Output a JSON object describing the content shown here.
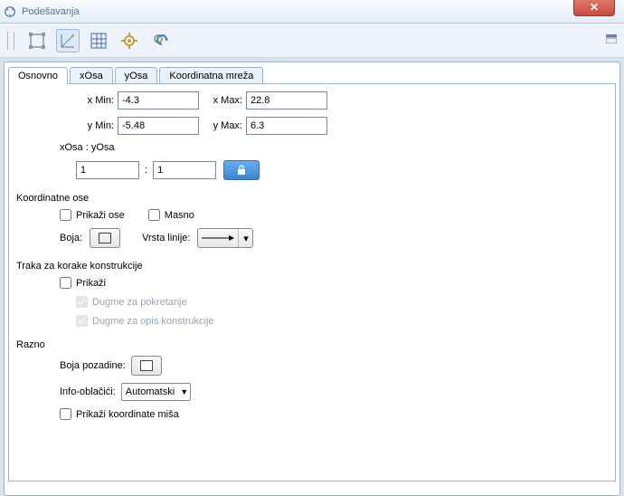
{
  "title": "Podešavanja",
  "tabs": {
    "t0": "Osnovno",
    "t1": "xOsa",
    "t2": "yOsa",
    "t3": "Koordinatna mreža"
  },
  "bounds": {
    "xmin_label": "x Min:",
    "xmin": "-4.3",
    "xmax_label": "x Max:",
    "xmax": "22.8",
    "ymin_label": "y Min:",
    "ymin": "-5.48",
    "ymax_label": "y Max:",
    "ymax": "6.3"
  },
  "ratio": {
    "label": "xOsa : yOsa",
    "x": "1",
    "sep": ":",
    "y": "1"
  },
  "axes": {
    "title": "Koordinatne ose",
    "show": "Prikaži ose",
    "bold": "Masno",
    "color_label": "Boja:",
    "color": "#000000",
    "linetype_label": "Vrsta linije:"
  },
  "construction": {
    "title": "Traka za korake konstrukcije",
    "show": "Prikaži",
    "play": "Dugme za pokretanje",
    "desc": "Dugme za opis konstrukcije"
  },
  "misc": {
    "title": "Razno",
    "bgcolor_label": "Boja pozadine:",
    "bgcolor": "#ffffff",
    "tooltips_label": "Info-oblačići:",
    "tooltips_value": "Automatski",
    "mouse": "Prikaži koordinate miša"
  }
}
